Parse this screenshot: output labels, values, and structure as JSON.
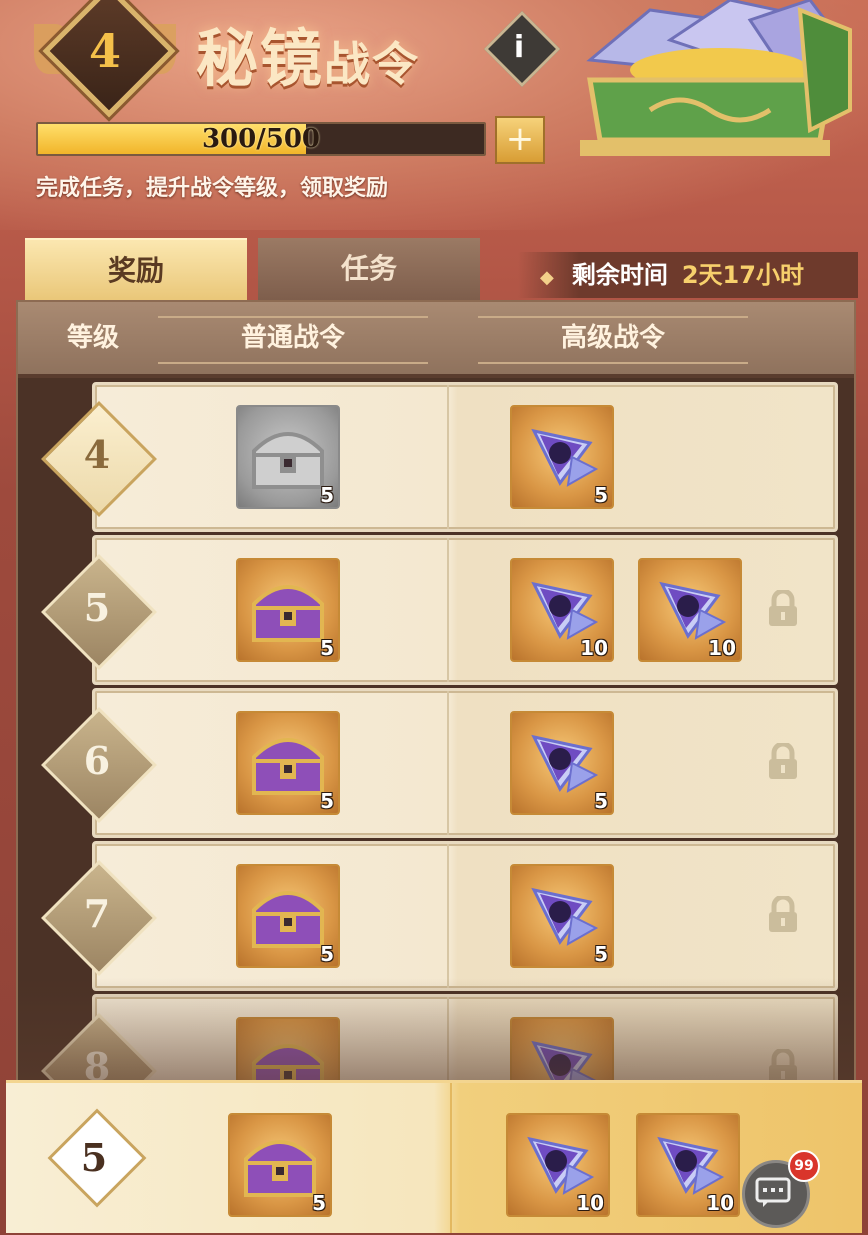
{
  "header": {
    "level": "4",
    "title_main": "秘镜",
    "title_sub": "战令",
    "info_label": "i",
    "progress_text": "300/500",
    "progress_fraction": 0.6,
    "plus_label": "+",
    "subtitle": "完成任务，提升战令等级，领取奖励"
  },
  "tabs": [
    {
      "label": "奖励",
      "active": true
    },
    {
      "label": "任务",
      "active": false
    }
  ],
  "timer": {
    "label": "剩余时间",
    "value": "2天17小时"
  },
  "table_header": {
    "level": "等级",
    "normal": "普通战令",
    "premium": "高级战令"
  },
  "rows": [
    {
      "level": "4",
      "normal": [
        {
          "icon": "silver-chest-icon",
          "count": "5"
        }
      ],
      "premium": [
        {
          "icon": "purple-crystal-icon",
          "count": "5"
        }
      ],
      "locked": false
    },
    {
      "level": "5",
      "normal": [
        {
          "icon": "purple-chest-icon",
          "count": "5"
        }
      ],
      "premium": [
        {
          "icon": "purple-crystal-icon",
          "count": "10"
        },
        {
          "icon": "purple-crystal-icon",
          "count": "10"
        }
      ],
      "locked": true
    },
    {
      "level": "6",
      "normal": [
        {
          "icon": "purple-chest-icon",
          "count": "5"
        }
      ],
      "premium": [
        {
          "icon": "purple-crystal-icon",
          "count": "5"
        }
      ],
      "locked": true
    },
    {
      "level": "7",
      "normal": [
        {
          "icon": "purple-chest-icon",
          "count": "5"
        }
      ],
      "premium": [
        {
          "icon": "purple-crystal-icon",
          "count": "5"
        }
      ],
      "locked": true
    },
    {
      "level": "8",
      "normal": [
        {
          "icon": "purple-chest-icon",
          "count": ""
        }
      ],
      "premium": [
        {
          "icon": "purple-crystal-icon",
          "count": ""
        }
      ],
      "locked": true
    }
  ],
  "bottom": {
    "level": "5",
    "normal": [
      {
        "icon": "purple-chest-icon",
        "count": "5"
      }
    ],
    "premium": [
      {
        "icon": "purple-crystal-icon",
        "count": "10"
      },
      {
        "icon": "purple-crystal-icon",
        "count": "10"
      }
    ]
  },
  "chat": {
    "badge": "99"
  }
}
